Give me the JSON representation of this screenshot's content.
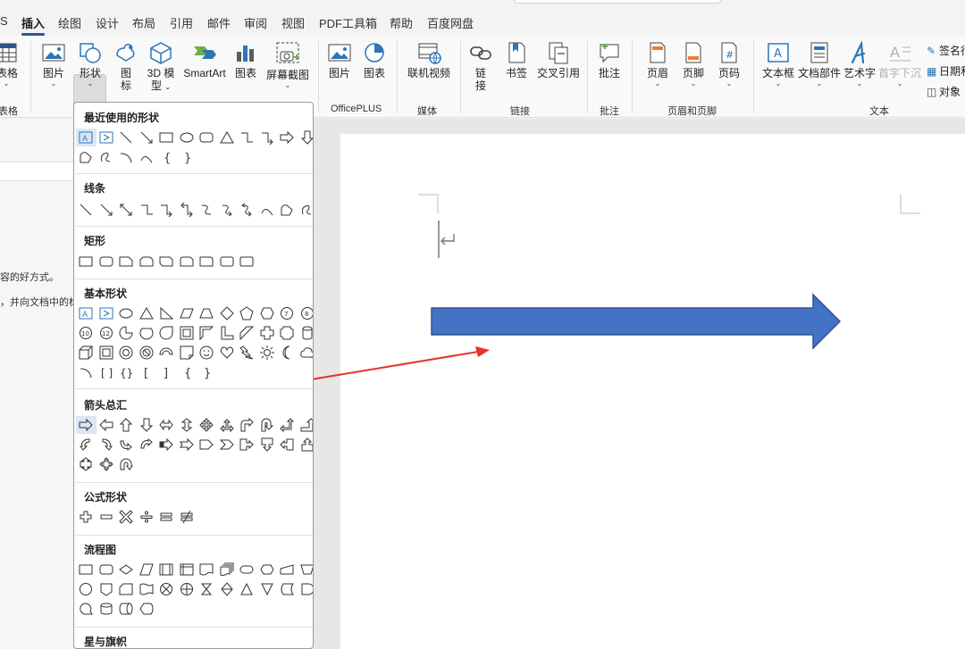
{
  "tabs": [
    {
      "id": "s",
      "label": "S",
      "active": false
    },
    {
      "id": "insert",
      "label": "插入",
      "active": true
    },
    {
      "id": "draw",
      "label": "绘图",
      "active": false
    },
    {
      "id": "design",
      "label": "设计",
      "active": false
    },
    {
      "id": "layout",
      "label": "布局",
      "active": false
    },
    {
      "id": "references",
      "label": "引用",
      "active": false
    },
    {
      "id": "mailings",
      "label": "邮件",
      "active": false
    },
    {
      "id": "review",
      "label": "审阅",
      "active": false
    },
    {
      "id": "view",
      "label": "视图",
      "active": false
    },
    {
      "id": "pdf",
      "label": "PDF工具箱",
      "active": false
    },
    {
      "id": "help",
      "label": "帮助",
      "active": false
    },
    {
      "id": "baidu",
      "label": "百度网盘",
      "active": false
    }
  ],
  "ribbon": {
    "table": {
      "label": "表格",
      "group": "表格"
    },
    "picture": {
      "label": "图片"
    },
    "shapes": {
      "label": "形状"
    },
    "icons": {
      "label": "图\n标",
      "l1": "图",
      "l2": "标"
    },
    "model3d": {
      "l1": "3D 模",
      "l2": "型"
    },
    "smartart": {
      "label": "SmartArt"
    },
    "chart": {
      "label": "图表"
    },
    "screenshot": {
      "label": "屏幕截图"
    },
    "op_picture": {
      "label": "图片"
    },
    "op_chart": {
      "label": "图表"
    },
    "op_group": "OfficePLUS",
    "online_video": {
      "label": "联机视频"
    },
    "media_group": "媒体",
    "link": {
      "l1": "链",
      "l2": "接"
    },
    "bookmark": {
      "label": "书签"
    },
    "crossref": {
      "label": "交叉引用"
    },
    "links_group": "链接",
    "comment": {
      "label": "批注"
    },
    "comment_group": "批注",
    "header": {
      "label": "页眉"
    },
    "footer": {
      "label": "页脚"
    },
    "pagenum": {
      "label": "页码"
    },
    "hf_group": "页眉和页脚",
    "textbox": {
      "label": "文本框"
    },
    "quickparts": {
      "label": "文档部件"
    },
    "wordart": {
      "label": "艺术字"
    },
    "dropcap": {
      "label": "首字下沉"
    },
    "signature": {
      "label": "签名行"
    },
    "datetime": {
      "label": "日期和时间"
    },
    "object": {
      "label": "对象"
    },
    "text_group": "文本"
  },
  "left_panel": {
    "line1": "容的好方式。",
    "line2": "，并向文档中的标"
  },
  "shapes_menu": {
    "sections": {
      "recent": "最近使用的形状",
      "lines": "线条",
      "rectangles": "矩形",
      "basic": "基本形状",
      "arrows": "箭头总汇",
      "equation": "公式形状",
      "flowchart": "流程图",
      "stars": "星与旗帜"
    }
  },
  "colors": {
    "arrow_fill": "#4472c4",
    "arrow_stroke": "#2f528f",
    "annotation_red": "#e8322a",
    "accent": "#2b579a"
  }
}
